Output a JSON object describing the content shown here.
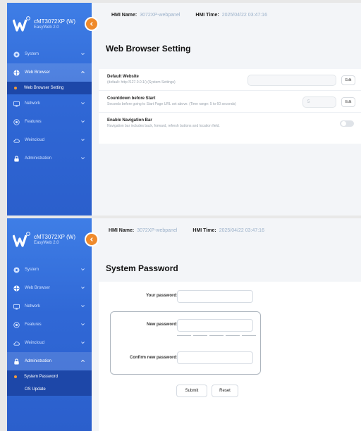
{
  "app": {
    "title": "cMT3072XP (W)",
    "subtitle": "EasyWeb 2.0",
    "accent": "#ef8a2b",
    "sidebar_color": "#3068d6"
  },
  "header": {
    "hmi_name_label": "HMI Name:",
    "hmi_name_value": "3072XP-webpanel",
    "hmi_time_label": "HMI Time:",
    "hmi_time_value": "2025/04/22 03:47:16"
  },
  "screen1": {
    "nav": [
      {
        "label": "System",
        "icon": "gear-icon"
      },
      {
        "label": "Web Browser",
        "icon": "globe-icon"
      },
      {
        "label": "Network",
        "icon": "network-icon"
      },
      {
        "label": "Features",
        "icon": "target-icon"
      },
      {
        "label": "Weincloud",
        "icon": "cloud-icon"
      },
      {
        "label": "Administration",
        "icon": "lock-icon"
      }
    ],
    "sub_items": [
      {
        "label": "Web Browser Setting"
      }
    ],
    "page_title": "Web Browser Setting",
    "settings": [
      {
        "title": "Default Website",
        "desc": "(default: http://127.0.0.1/) (System Settings)",
        "value": "",
        "button": "Edit"
      },
      {
        "title": "Countdown before Start",
        "desc": "Seconds before going to Start Page URL set above. (Time range: 5 to 60 seconds)",
        "value": "5",
        "button": "Edit"
      },
      {
        "title": "Enable Navigation Bar",
        "desc": "Navigation bar includes back, forward, refresh buttons and location field.",
        "toggle_on": false
      }
    ]
  },
  "screen2": {
    "nav": [
      {
        "label": "System",
        "icon": "gear-icon"
      },
      {
        "label": "Web Browser",
        "icon": "globe-icon"
      },
      {
        "label": "Network",
        "icon": "network-icon"
      },
      {
        "label": "Features",
        "icon": "target-icon"
      },
      {
        "label": "Weincloud",
        "icon": "cloud-icon"
      },
      {
        "label": "Administration",
        "icon": "lock-icon"
      }
    ],
    "sub_items": [
      {
        "label": "System Password"
      },
      {
        "label": "OS Update"
      }
    ],
    "page_title": "System Password",
    "form": {
      "your_password_label": "Your password:",
      "your_password_value": "",
      "new_password_label": "New password:",
      "new_password_value": "",
      "confirm_password_label": "Confirm new password:",
      "confirm_password_value": "",
      "submit_label": "Submit",
      "reset_label": "Reset"
    }
  }
}
